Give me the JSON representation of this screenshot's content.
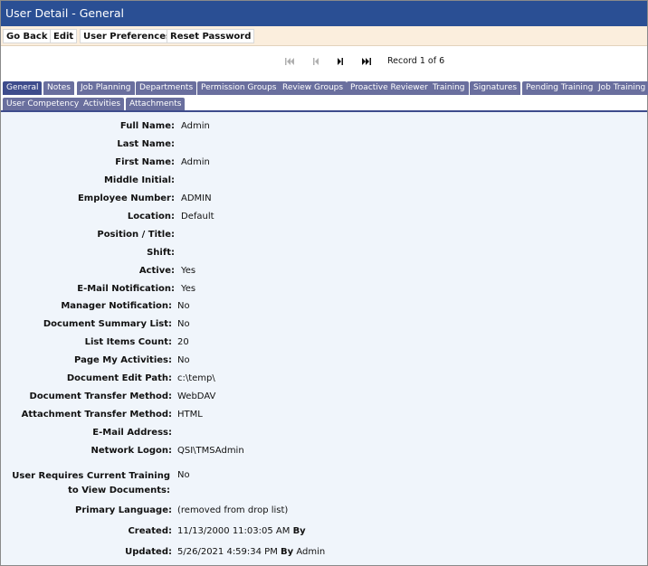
{
  "window": {
    "title": "User Detail - General"
  },
  "toolbar": {
    "go_back": "Go Back",
    "edit": "Edit",
    "user_preferences": "User Preferences",
    "reset_password": "Reset Password"
  },
  "nav": {
    "icons": [
      "first-record-icon",
      "previous-record-icon",
      "next-record-icon",
      "last-record-icon"
    ],
    "record_text": "Record 1 of 6"
  },
  "tabs": [
    "General",
    "Notes",
    "Job Planning",
    "Departments",
    "Permission Groups",
    "Review Groups",
    "Proactive Reviewer",
    "Training",
    "Signatures",
    "Pending Training",
    "Job Training",
    "User Competency",
    "Activities",
    "Attachments"
  ],
  "active_tab": "General",
  "fields": {
    "full_name": {
      "label": "Full Name:",
      "value": "Admin"
    },
    "last_name": {
      "label": "Last Name:",
      "value": ""
    },
    "first_name": {
      "label": "First Name:",
      "value": "Admin"
    },
    "middle_initial": {
      "label": "Middle Initial:",
      "value": ""
    },
    "employee_number": {
      "label": "Employee Number:",
      "value": "ADMIN"
    },
    "location": {
      "label": "Location:",
      "value": "Default"
    },
    "position_title": {
      "label": "Position / Title:",
      "value": ""
    },
    "shift": {
      "label": "Shift:",
      "value": ""
    },
    "active": {
      "label": "Active:",
      "value": "Yes"
    },
    "email_notification": {
      "label": "E-Mail Notification:",
      "value": "Yes"
    },
    "manager_notification": {
      "label": "Manager Notification:",
      "value": "No"
    },
    "document_summary_list": {
      "label": "Document Summary List:",
      "value": "No"
    },
    "list_items_count": {
      "label": "List Items Count:",
      "value": "20"
    },
    "page_my_activities": {
      "label": "Page My Activities:",
      "value": "No"
    },
    "document_edit_path": {
      "label": "Document Edit Path:",
      "value": "c:\\temp\\"
    },
    "document_transfer_method": {
      "label": "Document Transfer Method:",
      "value": "WebDAV"
    },
    "attachment_transfer_method": {
      "label": "Attachment Transfer Method:",
      "value": "HTML"
    },
    "email_address": {
      "label": "E-Mail Address:",
      "value": ""
    },
    "network_logon": {
      "label": "Network Logon:",
      "value": "QSI\\TMSAdmin"
    },
    "requires_training": {
      "label": "User Requires Current Training to View Documents:",
      "value": "No"
    },
    "primary_language": {
      "label": "Primary Language:",
      "value": "(removed from drop list)"
    },
    "created": {
      "label": "Created:",
      "date": "11/13/2000 11:03:05 AM",
      "by_label": "By",
      "by": ""
    },
    "updated": {
      "label": "Updated:",
      "date": "5/26/2021 4:59:34 PM",
      "by_label": "By",
      "by": "Admin"
    }
  },
  "colors": {
    "title_bar": "#2a4f94",
    "toolbar_bg": "#fbeedd",
    "tab_bg": "#6a6f9e",
    "tab_active": "#3e4c8c",
    "content_bg": "#f0f5fb"
  }
}
